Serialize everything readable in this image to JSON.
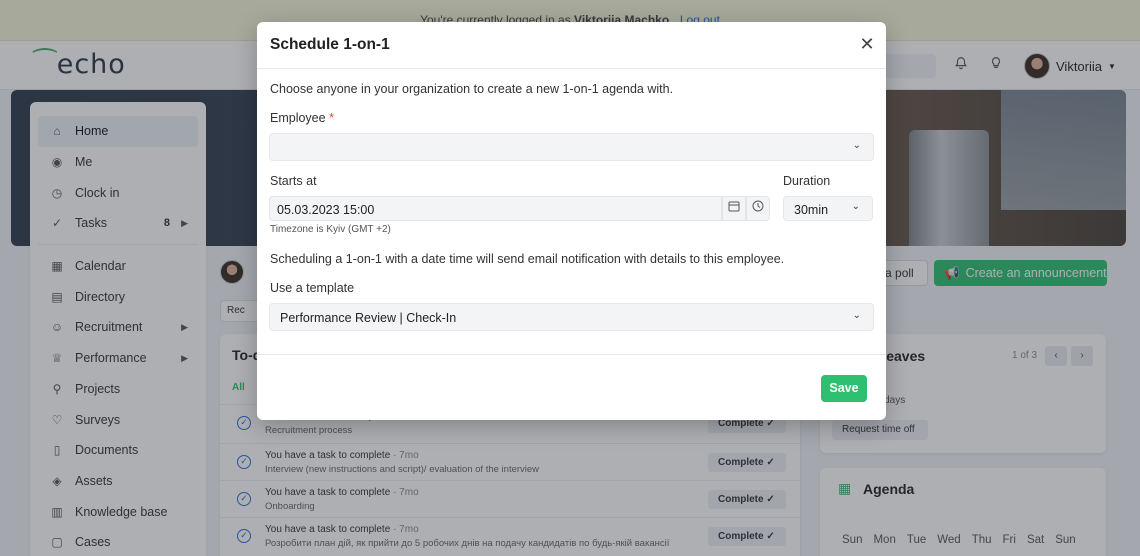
{
  "banner": {
    "prefix": "You're currently logged in as",
    "user": "Viktoriia Machko.",
    "logout": "Log out"
  },
  "header": {
    "logo": "echo",
    "user_name": "Viktoriia",
    "bell_icon": "bell-icon",
    "bulb_icon": "lightbulb-icon"
  },
  "sidebar": {
    "items": [
      {
        "label": "Home",
        "icon": "home-icon"
      },
      {
        "label": "Me",
        "icon": "user-circle-icon"
      },
      {
        "label": "Clock in",
        "icon": "clock-icon"
      },
      {
        "label": "Tasks",
        "icon": "check-circle-icon",
        "badge": "8"
      },
      {
        "label": "Calendar",
        "icon": "calendar-icon"
      },
      {
        "label": "Directory",
        "icon": "book-icon"
      },
      {
        "label": "Recruitment",
        "icon": "users-icon"
      },
      {
        "label": "Performance",
        "icon": "trophy-icon"
      },
      {
        "label": "Projects",
        "icon": "projects-icon"
      },
      {
        "label": "Surveys",
        "icon": "surveys-icon"
      },
      {
        "label": "Documents",
        "icon": "document-icon"
      },
      {
        "label": "Assets",
        "icon": "tag-icon"
      },
      {
        "label": "Knowledge base",
        "icon": "knowledge-icon"
      },
      {
        "label": "Cases",
        "icon": "chat-icon"
      }
    ]
  },
  "main": {
    "poll_label": "e a poll",
    "announce_label": "Create an announcement",
    "rec_label": "Rec",
    "todo": {
      "title": "To-d",
      "filter_all": "All",
      "tasks": [
        {
          "title": "You have a task to complete",
          "ago": "· 7mo",
          "desc": "Recruitment process",
          "button": "Complete"
        },
        {
          "title": "You have a task to complete",
          "ago": "· 7mo",
          "desc": "Interview (new instructions and script)/ evaluation of the interview",
          "button": "Complete"
        },
        {
          "title": "You have a task to complete",
          "ago": "· 7mo",
          "desc": "Onboarding",
          "button": "Complete"
        },
        {
          "title": "You have a task to complete",
          "ago": "· 7mo",
          "desc": "Розробити план дій, як прийти до 5 робочих днів на подачу кандидатів по будь-якій вакансії",
          "button": "Complete"
        }
      ]
    },
    "leaves": {
      "title": "k Leaves",
      "pager": "1 of 3",
      "days": "ble days",
      "request": "Request time off"
    },
    "agenda": {
      "title": "Agenda",
      "days": [
        "Sun",
        "Mon",
        "Tue",
        "Wed",
        "Thu",
        "Fri",
        "Sat",
        "Sun"
      ]
    }
  },
  "modal": {
    "title": "Schedule 1-on-1",
    "intro": "Choose anyone in your organization to create a new 1-on-1 agenda with.",
    "employee_label": "Employee",
    "required_mark": "*",
    "employee_value": "",
    "starts_label": "Starts at",
    "starts_value": "05.03.2023 15:00",
    "timezone": "Timezone is Kyiv (GMT +2)",
    "duration_label": "Duration",
    "duration_value": "30min",
    "notice": "Scheduling a 1-on-1 with a date time will send email notification with details to this employee.",
    "template_label": "Use a template",
    "template_value": "Performance Review | Check-In",
    "save": "Save"
  },
  "colors": {
    "accent": "#2fbf71",
    "link": "#2b6cd6",
    "required": "#e0453c"
  }
}
